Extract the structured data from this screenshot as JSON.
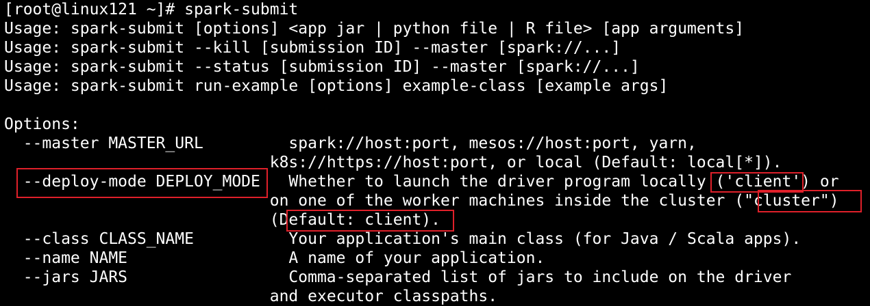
{
  "terminal": {
    "prompt": "[root@linux121 ~]# ",
    "command": "spark-submit",
    "usage": [
      "Usage: spark-submit [options] <app jar | python file | R file> [app arguments]",
      "Usage: spark-submit --kill [submission ID] --master [spark://...]",
      "Usage: spark-submit --status [submission ID] --master [spark://...]",
      "Usage: spark-submit run-example [options] example-class [example args]"
    ],
    "options_header": "Options:",
    "options": {
      "master": {
        "flag": "  --master MASTER_URL         ",
        "desc1": "spark://host:port, mesos://host:port, yarn,",
        "desc2": "k8s://https://host:port, or local (Default: local[*])."
      },
      "deploy_mode": {
        "flag": "  --deploy-mode DEPLOY_MODE   ",
        "desc1": "Whether to launch the driver program locally ('client') or",
        "desc2": "on one of the worker machines inside the cluster (\"cluster\")",
        "desc3": "(Default: client)."
      },
      "class": {
        "flag": "  --class CLASS_NAME          ",
        "desc": "Your application's main class (for Java / Scala apps)."
      },
      "name": {
        "flag": "  --name NAME                 ",
        "desc": "A name of your application."
      },
      "jars": {
        "flag": "  --jars JARS                 ",
        "desc1": "Comma-separated list of jars to include on the driver",
        "desc2": "and executor classpaths."
      }
    },
    "indent": "                            "
  },
  "colors": {
    "background": "#000000",
    "text": "#ffffff",
    "highlight": "#e0202a"
  }
}
